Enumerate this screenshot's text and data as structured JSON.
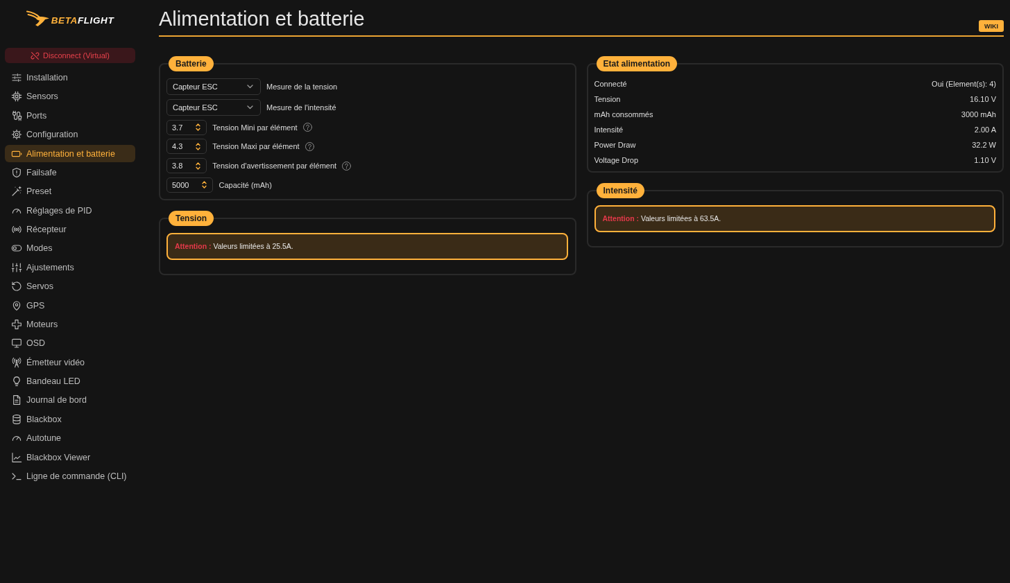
{
  "sidebar": {
    "logo": {
      "accent": "BETA",
      "rest": "FLIGHT"
    },
    "disconnect_button": "Disconnect (Virtual)",
    "items": [
      {
        "label": "Installation",
        "selected": false
      },
      {
        "label": "Sensors",
        "selected": false
      },
      {
        "label": "Ports",
        "selected": false
      },
      {
        "label": "Configuration",
        "selected": false
      },
      {
        "label": "Alimentation et batterie",
        "selected": true
      },
      {
        "label": "Failsafe",
        "selected": false
      },
      {
        "label": "Preset",
        "selected": false
      },
      {
        "label": "Réglages de PID",
        "selected": false
      },
      {
        "label": "Récepteur",
        "selected": false
      },
      {
        "label": "Modes",
        "selected": false
      },
      {
        "label": "Ajustements",
        "selected": false
      },
      {
        "label": "Servos",
        "selected": false
      },
      {
        "label": "GPS",
        "selected": false
      },
      {
        "label": "Moteurs",
        "selected": false
      },
      {
        "label": "OSD",
        "selected": false
      },
      {
        "label": "Émetteur vidéo",
        "selected": false
      },
      {
        "label": "Bandeau LED",
        "selected": false
      },
      {
        "label": "Journal de bord",
        "selected": false
      },
      {
        "label": "Blackbox",
        "selected": false
      },
      {
        "label": "Autotune",
        "selected": false
      },
      {
        "label": "Blackbox Viewer",
        "selected": false
      },
      {
        "label": "Ligne de commande (CLI)",
        "selected": false
      }
    ]
  },
  "header": {
    "title": "Alimentation et batterie",
    "wiki_button": "WIKI"
  },
  "columns": [
    [
      {
        "kind": "form",
        "legend": "Batterie",
        "selects": [
          {
            "value": "Capteur ESC",
            "label": "Mesure de la tension"
          },
          {
            "value": "Capteur ESC",
            "label": "Mesure de l'intensité"
          }
        ],
        "number_inputs": [
          {
            "value": "3.7",
            "label": "Tension Mini par élément",
            "help": true
          },
          {
            "value": "4.3",
            "label": "Tension Maxi par élément",
            "help": true
          },
          {
            "value": "3.8",
            "label": "Tension d'avertissement par élément",
            "help": true
          },
          {
            "value": "5000",
            "label": "Capacité (mAh)",
            "help": false
          }
        ]
      },
      {
        "kind": "note",
        "legend": "Tension",
        "note": "**Attention :** Valeurs limitées à 25.5A."
      }
    ],
    [
      {
        "kind": "status",
        "legend": "Etat alimentation",
        "rows": [
          {
            "label": "Connecté",
            "value": "Oui (Element(s): 4)"
          },
          {
            "label": "Tension",
            "value": "16.10 V"
          },
          {
            "label": "mAh consommés",
            "value": "3000 mAh"
          },
          {
            "label": "Intensité",
            "value": "2.00 A"
          },
          {
            "label": "Power Draw",
            "value": "32.2 W"
          },
          {
            "label": "Voltage Drop",
            "value": "1.10 V"
          }
        ]
      },
      {
        "kind": "note",
        "legend": "Intensité",
        "note": "**Attention :** Valeurs limitées à 63.5A."
      }
    ]
  ]
}
